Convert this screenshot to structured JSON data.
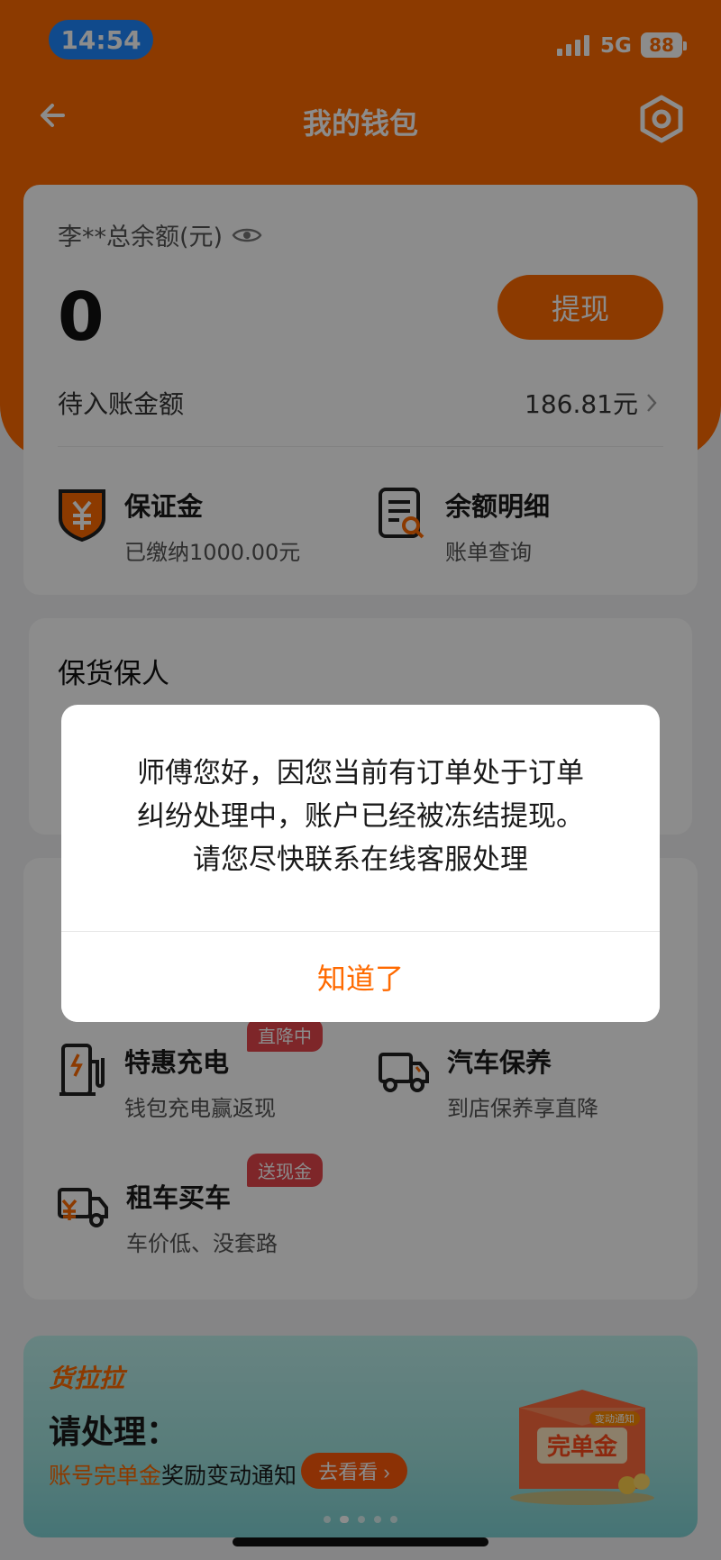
{
  "status_bar": {
    "time": "14:54",
    "network": "5G",
    "battery": "88"
  },
  "nav": {
    "title": "我的钱包",
    "back_icon": "back-arrow-icon",
    "settings_icon": "settings-hexagon-icon"
  },
  "balance_card": {
    "label": "李**总余额(元)",
    "amount": "0",
    "withdraw_label": "提现",
    "pending_label": "待入账金额",
    "pending_value": "186.81元",
    "features": [
      {
        "title": "保证金",
        "subtitle": "已缴纳1000.00元",
        "icon": "deposit-shield-icon"
      },
      {
        "title": "余额明细",
        "subtitle": "账单查询",
        "icon": "statement-search-icon"
      }
    ]
  },
  "insurance_card": {
    "title": "保货保人"
  },
  "services": [
    {
      "title": "特惠充电",
      "subtitle": "钱包充电赢返现",
      "tag": "直降中",
      "icon": "charging-station-icon"
    },
    {
      "title": "汽车保养",
      "subtitle": "到店保养享直降",
      "icon": "truck-icon"
    },
    {
      "title": "租车买车",
      "subtitle": "车价低、没套路",
      "tag": "送现金",
      "icon": "truck-yuan-icon"
    }
  ],
  "banner": {
    "logo": "货拉拉",
    "title": "请处理：",
    "subtitle_highlight": "账号完单金",
    "subtitle_rest": "奖励变动通知",
    "button": "去看看 ›",
    "box_label": "完单金",
    "box_tag": "变动通知"
  },
  "dialog": {
    "message_lines": [
      "师傅您好，因您当前有订单处于订单",
      "纠纷处理中，账户已经被冻结提现。",
      "请您尽快联系在线客服处理"
    ],
    "confirm": "知道了"
  },
  "colors": {
    "brand": "#ff6a00",
    "tag": "#e5464b"
  }
}
